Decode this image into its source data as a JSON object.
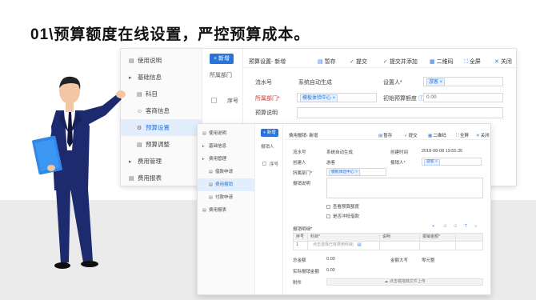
{
  "headline": "01\\预算额度在线设置，严控预算成本。",
  "back_window": {
    "sidebar": [
      {
        "label": "使用说明",
        "icon": "doc-icon"
      },
      {
        "label": "基础信息",
        "icon": "folder-icon"
      },
      {
        "label": "科目",
        "icon": "ledger-icon",
        "sub": true
      },
      {
        "label": "客商信息",
        "icon": "user-icon",
        "sub": true
      },
      {
        "label": "预算设置",
        "icon": "settings-icon",
        "sub": true,
        "active": true
      },
      {
        "label": "预算调整",
        "icon": "adjust-icon",
        "sub": true
      },
      {
        "label": "费用管理",
        "icon": "folder-icon"
      },
      {
        "label": "费用报表",
        "icon": "report-icon"
      }
    ],
    "new_button": "+ 新增",
    "list_label": "所属部门",
    "seq_label": "序号",
    "title": "预算设置- 新增",
    "toolbar": [
      "暂存",
      "提交",
      "提交并添加",
      "二维码",
      "全屏",
      "关闭"
    ],
    "form": {
      "serial_label": "流水号",
      "serial_value": "系统自动生成",
      "setter_label": "设置人*",
      "setter_value": "游客",
      "dept_label": "所属部门*",
      "dept_value": "模板体验中心",
      "init_label": "初始预算额度",
      "init_value": "0.00",
      "desc_label": "预算说明"
    }
  },
  "front_window": {
    "sidebar": [
      {
        "label": "使用说明",
        "icon": "doc-icon"
      },
      {
        "label": "基础信息",
        "icon": "folder-icon"
      },
      {
        "label": "费用管理",
        "icon": "folder-icon"
      },
      {
        "label": "借款申请",
        "icon": "doc-icon",
        "sub": true
      },
      {
        "label": "费用报销",
        "icon": "expense-icon",
        "sub": true,
        "active": true
      },
      {
        "label": "付款申请",
        "icon": "doc-icon",
        "sub": true
      },
      {
        "label": "费用报表",
        "icon": "report-icon"
      }
    ],
    "new_button": "+ 新增",
    "list_label": "报销人",
    "seq_label": "序号",
    "title": "费用报销- 新增",
    "toolbar": [
      "暂存",
      "提交",
      "二维码",
      "全屏",
      "关闭"
    ],
    "form": {
      "serial_label": "流水号",
      "serial_value": "系统自动生成",
      "created_label": "创建时间",
      "created_value": "2018-08-08 19:55:35",
      "creator_label": "创建人",
      "creator_value": "游客",
      "claimant_label": "报销人*",
      "claimant_value": "游客",
      "dept_label": "所属部门*",
      "dept_value": "模板体验中心",
      "desc_label": "报销说明",
      "check1": "查看预算额度",
      "check2": "是否冲抵借款",
      "detail_label": "报销明细*",
      "table_headers": [
        "序号",
        "科目*",
        "说明",
        "报销金额*",
        ""
      ],
      "row_seq": "1",
      "row_placeholder": "点击选择已有费用科目",
      "total_label": "总金额",
      "total_value": "0.00",
      "upper_label": "金额大写",
      "upper_value": "零元整",
      "actual_label": "实际报销金额",
      "actual_value": "0.00",
      "attach_label": "附件",
      "upload_text": "点击或拖拽文件上传"
    }
  },
  "colors": {
    "accent": "#2a74d9",
    "suit": "#1e2a6e",
    "floor": "#ebebeb"
  }
}
